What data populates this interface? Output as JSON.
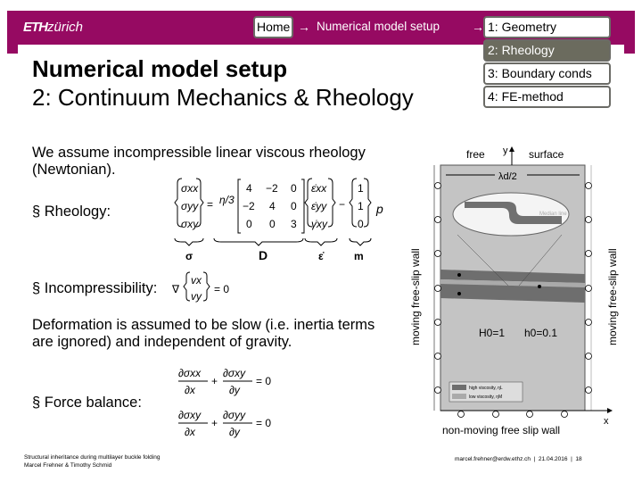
{
  "header": {
    "logo": {
      "bold": "ETH",
      "light": "zürich"
    },
    "breadcrumb": {
      "home": "Home",
      "arrow": "→",
      "section": "Numerical model setup"
    },
    "nav": [
      {
        "label": "1: Geometry",
        "active": false
      },
      {
        "label": "2: Rheology",
        "active": true
      },
      {
        "label": "3: Boundary conds",
        "active": false
      },
      {
        "label": "4: FE-method",
        "active": false
      }
    ],
    "brand_color": "#960a62"
  },
  "title": "Numerical model setup",
  "subtitle": "2: Continuum Mechanics & Rheology",
  "content": {
    "intro": "We assume incompressible linear viscous rheology (Newtonian).",
    "rheology_label": "§ Rheology:",
    "incompressibility_label": "§ Incompressibility:",
    "deformation_note": "Deformation is assumed to be slow (i.e. inertia terms are ignored) and independent of gravity.",
    "force_balance_label": "§ Force balance:",
    "rheology_eq": {
      "sigma": [
        "σxx",
        "σyy",
        "σxy"
      ],
      "coef": "η/3",
      "matrix": [
        [
          "4",
          "−2",
          "0"
        ],
        [
          "−2",
          "4",
          "0"
        ],
        [
          "0",
          "0",
          "3"
        ]
      ],
      "strain": [
        "ε̇xx",
        "ε̇yy",
        "γ̇xy"
      ],
      "m": [
        "1",
        "1",
        "0"
      ],
      "p": "p",
      "labels": {
        "sigma": "σ",
        "D": "D",
        "eps": "ε̇",
        "m": "m"
      }
    },
    "incompressibility_eq": {
      "nabla": "∇",
      "v": [
        "vx",
        "vy"
      ],
      "rhs": "= 0"
    },
    "force_balance_eq": [
      {
        "a": "∂σxx",
        "b": "∂x",
        "c": "∂σxy",
        "d": "∂y",
        "rhs": "= 0"
      },
      {
        "a": "∂σxy",
        "b": "∂x",
        "c": "∂σyy",
        "d": "∂y",
        "rhs": "= 0"
      }
    ]
  },
  "figure": {
    "top_left": "free",
    "top_right": "surface",
    "y_axis": "y",
    "x_axis": "x",
    "wavelength": "λd/2",
    "median_line": "Median line",
    "left_wall": "moving free-slip wall",
    "right_wall": "moving free-slip wall",
    "bottom_wall": "non-moving free slip wall",
    "H0": "H0=1",
    "h0": "h0=0.1",
    "legend": [
      "high viscosity, ηL",
      "low viscosity, ηM"
    ]
  },
  "footer": {
    "line1": "Structural inheritance during multilayer buckle folding",
    "line2": "Marcel Frehner & Timothy Schmid",
    "email": "marcel.frehner@erdw.ethz.ch",
    "date": "21.04.2016",
    "page": "18"
  }
}
